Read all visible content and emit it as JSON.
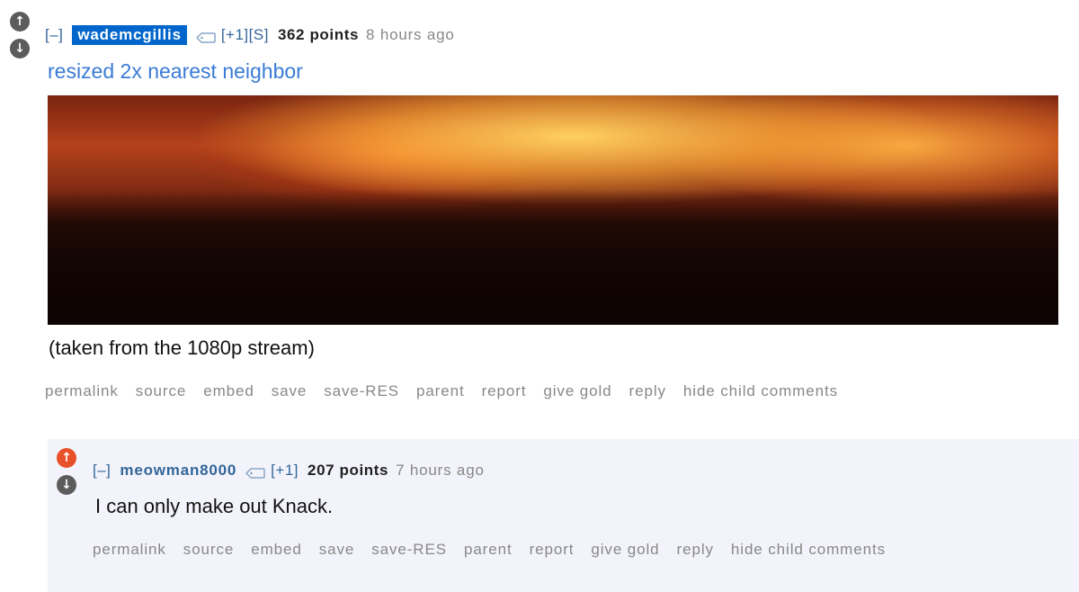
{
  "parent_comment": {
    "collapse_label": "[–]",
    "author": "wademcgillis",
    "meta": "[+1][S]",
    "points": "362 points",
    "time": "8 hours ago",
    "link_text": "resized 2x nearest neighbor",
    "body": "(taken from the 1080p stream)",
    "buttons": [
      "permalink",
      "source",
      "embed",
      "save",
      "save-RES",
      "parent",
      "report",
      "give gold",
      "reply",
      "hide child comments"
    ]
  },
  "child_comment": {
    "collapse_label": "[–]",
    "author": "meowman8000",
    "meta": "[+1]",
    "points": "207 points",
    "time": "7 hours ago",
    "body": "I can only make out Knack.",
    "buttons": [
      "permalink",
      "source",
      "embed",
      "save",
      "save-RES",
      "parent",
      "report",
      "give gold",
      "reply",
      "hide child comments"
    ]
  },
  "icons": {
    "upvote": "upvote-arrow-icon",
    "downvote": "downvote-arrow-icon",
    "tag": "tag-icon"
  },
  "colors": {
    "author_highlight_bg": "#0066cc",
    "link_blue": "#3a7bd5",
    "upvote_active": "#e8502a",
    "child_panel_bg": "#f3f4fb"
  }
}
